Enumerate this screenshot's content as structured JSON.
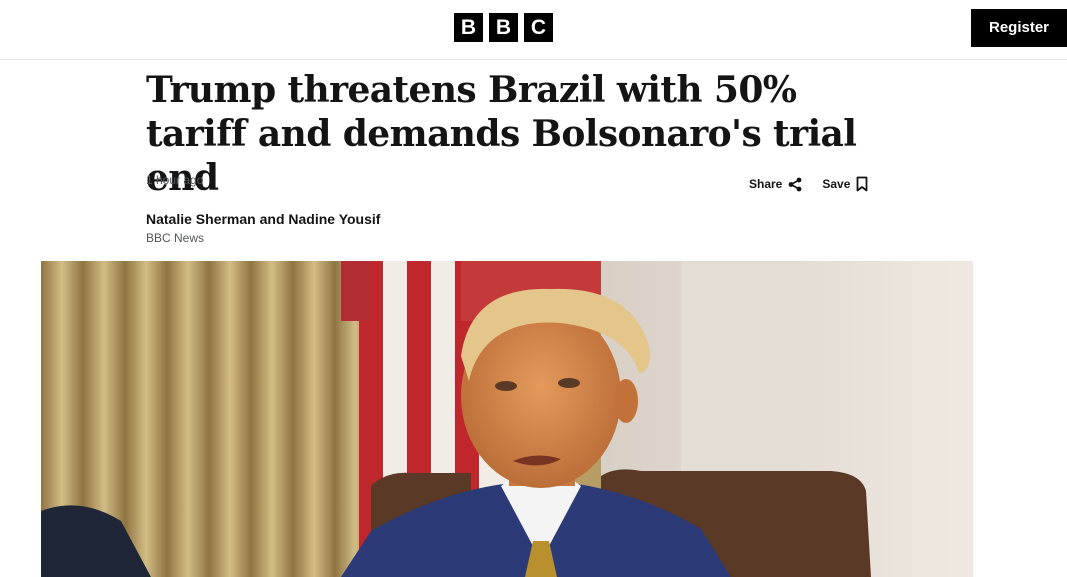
{
  "header": {
    "logo_letters": [
      "B",
      "B",
      "C"
    ],
    "register_label": "Register"
  },
  "article": {
    "headline": "Trump threatens Brazil with 50% tariff and demands Bolsonaro's trial end",
    "timestamp": "1 hour ago",
    "share_label": "Share",
    "save_label": "Save",
    "authors": "Natalie Sherman and Nadine Yousif",
    "source": "BBC News"
  },
  "icons": {
    "share": "share-icon",
    "save": "bookmark-icon"
  },
  "colors": {
    "brand_black": "#000000",
    "text_primary": "#141414",
    "text_secondary": "#545658"
  }
}
